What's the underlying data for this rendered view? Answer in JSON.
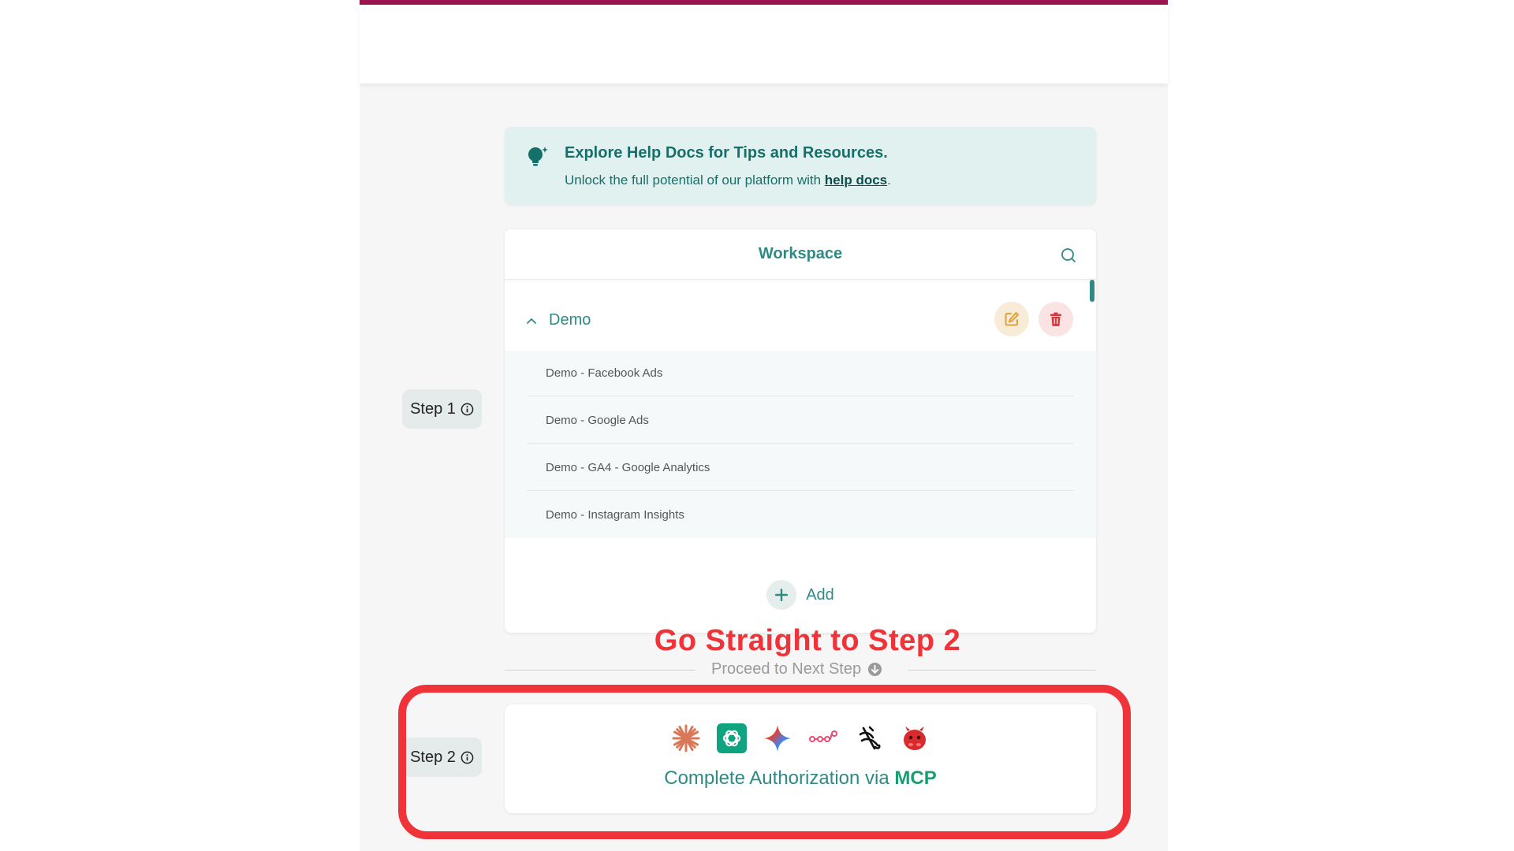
{
  "help_banner": {
    "title": "Explore Help Docs for Tips and Resources.",
    "subtitle_prefix": "Unlock the full potential of our platform with ",
    "link_text": "help docs",
    "subtitle_suffix": "."
  },
  "steps": {
    "step1_label": "Step 1",
    "step2_label": "Step 2"
  },
  "workspace": {
    "title": "Workspace",
    "group": {
      "label": "Demo",
      "items": [
        "Demo - Facebook Ads",
        "Demo - Google Ads",
        "Demo - GA4 - Google Analytics",
        "Demo - Instagram Insights"
      ]
    },
    "add_label": "Add"
  },
  "annotation": {
    "callout": "Go Straight to Step 2"
  },
  "proceed": {
    "label": "Proceed to Next Step"
  },
  "mcp": {
    "text_prefix": "Complete Authorization via ",
    "text_strong": "MCP",
    "logos": [
      "claude-logo-icon",
      "chatgpt-logo-icon",
      "gemini-logo-icon",
      "n8n-logo-icon",
      "cursor-logo-icon",
      "red-bot-logo-icon"
    ]
  },
  "colors": {
    "brand_bar": "#9b1550",
    "teal": "#2f8a85",
    "banner_bg": "#e1f1f0",
    "callout_red": "#ef3338",
    "mcp_green": "#1d9c73"
  }
}
